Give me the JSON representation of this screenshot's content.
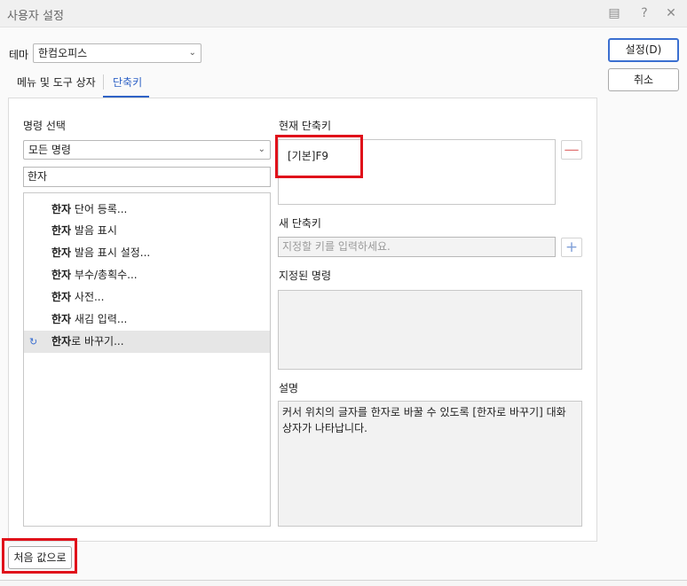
{
  "window": {
    "title": "사용자 설정"
  },
  "theme": {
    "label": "테마",
    "value": "한컴오피스"
  },
  "tabs": [
    {
      "label": "메뉴 및 도구 상자"
    },
    {
      "label": "단축키"
    }
  ],
  "buttons": {
    "ok": "설정(D)",
    "cancel": "취소",
    "reset": "처음 값으로"
  },
  "command_select": {
    "label": "명령 선택",
    "category": "모든 명령",
    "search_value": "한자",
    "items": [
      {
        "bold": "한자",
        "rest": " 단어 등록..."
      },
      {
        "bold": "한자",
        "rest": " 발음 표시"
      },
      {
        "bold": "한자",
        "rest": " 발음 표시 설정..."
      },
      {
        "bold": "한자",
        "rest": " 부수/총획수..."
      },
      {
        "bold": "한자",
        "rest": " 사전..."
      },
      {
        "bold": "한자",
        "rest": " 새김 입력..."
      },
      {
        "bold": "한자",
        "rest": "로 바꾸기..."
      }
    ]
  },
  "current_shortcut": {
    "label": "현재 단축키",
    "value": "[기본]F9"
  },
  "new_shortcut": {
    "label": "새 단축키",
    "placeholder": "지정할 키를 입력하세요."
  },
  "assigned": {
    "label": "지정된 명령"
  },
  "description": {
    "label": "설명",
    "text": "커서 위치의 글자를 한자로 바꿀 수 있도록 [한자로 바꾸기] 대화 상자가 나타납니다."
  }
}
